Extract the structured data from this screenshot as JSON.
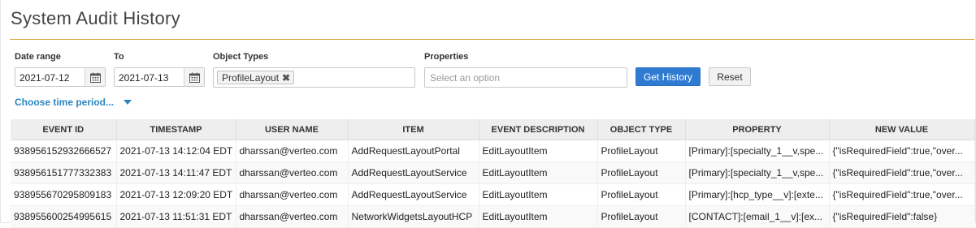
{
  "page": {
    "title": "System Audit History"
  },
  "filters": {
    "date_range_label": "Date range",
    "date_from": "2021-07-12",
    "to_label": "To",
    "date_to": "2021-07-13",
    "object_types_label": "Object Types",
    "object_type_chip": "ProfileLayout",
    "properties_label": "Properties",
    "properties_placeholder": "Select an option",
    "get_history_label": "Get History",
    "reset_label": "Reset",
    "time_period_label": "Choose time period..."
  },
  "colors": {
    "accent_rule": "#d9a13a",
    "primary_button": "#2f7bd2",
    "link": "#2a86c1"
  },
  "table": {
    "columns": [
      "EVENT ID",
      "TIMESTAMP",
      "USER NAME",
      "ITEM",
      "EVENT DESCRIPTION",
      "OBJECT TYPE",
      "PROPERTY",
      "NEW VALUE"
    ],
    "rows": [
      [
        "938956152932666527",
        "2021-07-13 14:12:04 EDT",
        "dharssan@verteo.com",
        "AddRequestLayoutPortal",
        "EditLayoutItem",
        "ProfileLayout",
        "[Primary]:[specialty_1__v,spe...",
        "{\"isRequiredField\":true,\"over..."
      ],
      [
        "938956151777332383",
        "2021-07-13 14:11:47 EDT",
        "dharssan@verteo.com",
        "AddRequestLayoutService",
        "EditLayoutItem",
        "ProfileLayout",
        "[Primary]:[specialty_1__v,spe...",
        "{\"isRequiredField\":true,\"over..."
      ],
      [
        "938955670295809183",
        "2021-07-13 12:09:20 EDT",
        "dharssan@verteo.com",
        "AddRequestLayoutService",
        "EditLayoutItem",
        "ProfileLayout",
        "[Primary]:[hcp_type__v]:[exte...",
        "{\"isRequiredField\":true,\"over..."
      ],
      [
        "938955600254995615",
        "2021-07-13 11:51:31 EDT",
        "dharssan@verteo.com",
        "NetworkWidgetsLayoutHCP",
        "EditLayoutItem",
        "ProfileLayout",
        "[CONTACT]:[email_1__v]:[ex...",
        "{\"isRequiredField\":false}"
      ]
    ]
  }
}
